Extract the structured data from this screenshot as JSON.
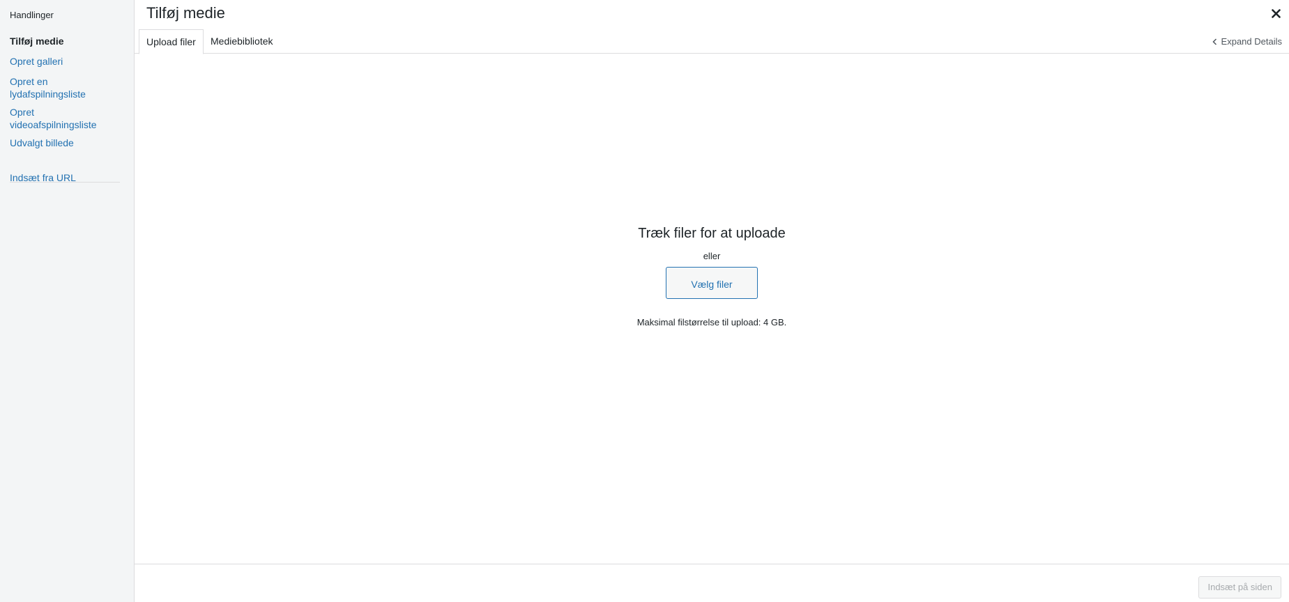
{
  "sidebar": {
    "heading": "Handlinger",
    "items": [
      {
        "label": "Tilføj medie",
        "active": true
      },
      {
        "label": "Opret galleri"
      },
      {
        "label": "Opret en lydafspilningsliste"
      },
      {
        "label": "Opret videoafspilningsliste"
      },
      {
        "label": "Udvalgt billede"
      }
    ],
    "extra_items": [
      {
        "label": "Indsæt fra URL"
      }
    ]
  },
  "header": {
    "title": "Tilføj medie",
    "close_icon": "close-icon"
  },
  "tabs": [
    {
      "label": "Upload filer",
      "active": true
    },
    {
      "label": "Mediebibliotek"
    }
  ],
  "expand_details": {
    "label": "Expand Details",
    "icon": "chevron-left-icon"
  },
  "upload": {
    "title": "Træk filer for at uploade",
    "or": "eller",
    "select_button": "Vælg filer",
    "max_size": "Maksimal filstørrelse til upload: 4 GB."
  },
  "footer": {
    "insert_button": "Indsæt på siden"
  },
  "colors": {
    "accent": "#2271b1",
    "sidebar_bg": "#f3f5f6",
    "border": "#dcdcde",
    "disabled_text": "#a7aaad"
  }
}
